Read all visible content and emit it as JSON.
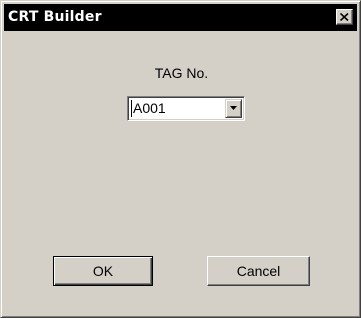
{
  "window": {
    "title": "CRT Builder",
    "close_icon": "close-icon"
  },
  "form": {
    "tag_label": "TAG No.",
    "tag_value": "A001",
    "dropdown_icon": "chevron-down-icon"
  },
  "buttons": {
    "ok_label": "OK",
    "cancel_label": "Cancel"
  },
  "colors": {
    "titlebar": "#000000",
    "title_text": "#ffffff",
    "dialog_face": "#d4d0c8"
  }
}
